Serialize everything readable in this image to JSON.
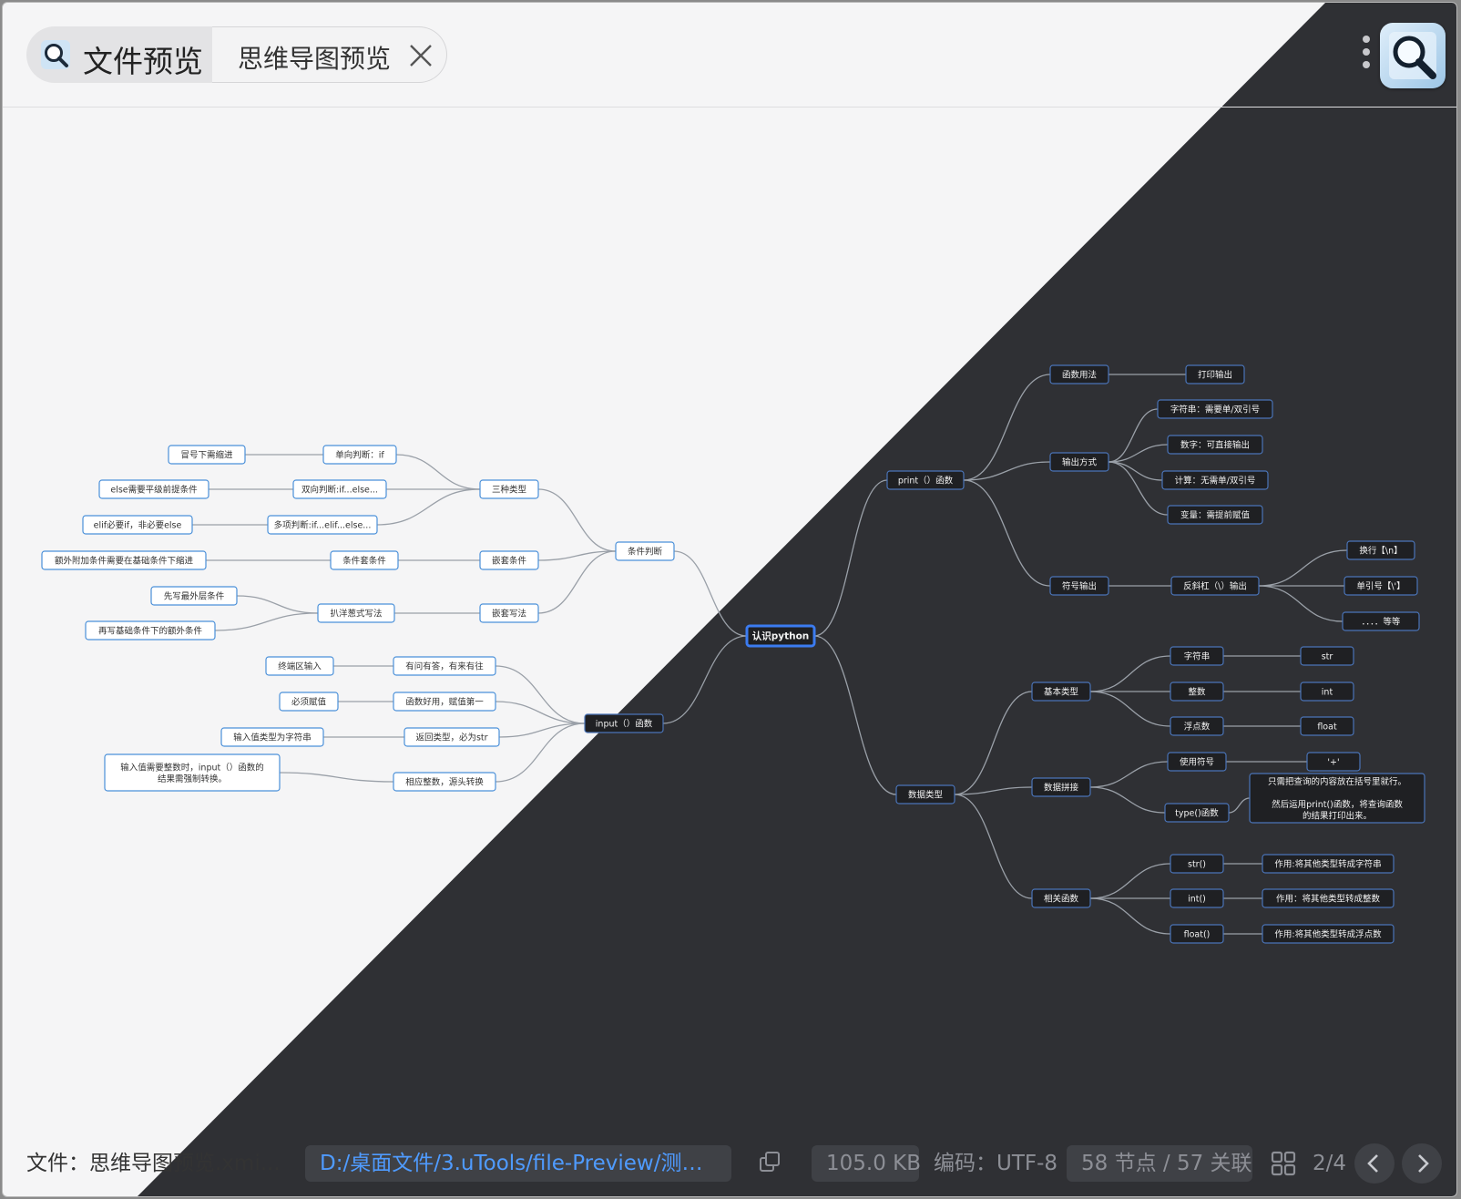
{
  "header": {
    "tab_main_label": "文件预览",
    "tab_sub_label": "思维导图预览"
  },
  "footer": {
    "file_label": "文件：思维导图预览.xmi...",
    "file_path": "D:/桌面文件/3.uTools/file-Preview/测试文...",
    "file_size": "105.0 KB",
    "encoding": "编码：UTF-8",
    "stats": "58 节点 / 57 关联",
    "page_indicator": "2/4"
  },
  "colors": {
    "light_bg": "#f5f5f6",
    "dark_bg": "#2f3034",
    "node_border_light": "#4a90d9",
    "node_border_dark": "#4a74b8",
    "root_border": "#3b7bf0",
    "edge": "#9aa0a8",
    "link": "#4f9bff"
  },
  "mindmap": {
    "root": "认识python",
    "nodes": [
      {
        "id": "root",
        "text": "认识python"
      },
      {
        "id": "print",
        "text": "print（）函数",
        "parent": "root"
      },
      {
        "id": "hs",
        "text": "函数用法",
        "parent": "print"
      },
      {
        "id": "dy",
        "text": "打印输出",
        "parent": "hs"
      },
      {
        "id": "sc",
        "text": "输出方式",
        "parent": "print"
      },
      {
        "id": "sc1",
        "text": "字符串：需要单/双引号",
        "parent": "sc"
      },
      {
        "id": "sc2",
        "text": "数字：可直接输出",
        "parent": "sc"
      },
      {
        "id": "sc3",
        "text": "计算：无需单/双引号",
        "parent": "sc"
      },
      {
        "id": "sc4",
        "text": "变量：需提前赋值",
        "parent": "sc"
      },
      {
        "id": "fh",
        "text": "符号输出",
        "parent": "print"
      },
      {
        "id": "fxg",
        "text": "反斜杠（\\）输出",
        "parent": "fh"
      },
      {
        "id": "fx1",
        "text": "换行【\\n】",
        "parent": "fxg"
      },
      {
        "id": "fx2",
        "text": "单引号【\\'】",
        "parent": "fxg"
      },
      {
        "id": "fx3",
        "text": "．．．．等等",
        "parent": "fxg"
      },
      {
        "id": "sjlx",
        "text": "数据类型",
        "parent": "root"
      },
      {
        "id": "jb",
        "text": "基本类型",
        "parent": "sjlx"
      },
      {
        "id": "zfc",
        "text": "字符串",
        "parent": "jb"
      },
      {
        "id": "str",
        "text": "str",
        "parent": "zfc"
      },
      {
        "id": "zs",
        "text": "整数",
        "parent": "jb"
      },
      {
        "id": "int",
        "text": "int",
        "parent": "zs"
      },
      {
        "id": "fds",
        "text": "浮点数",
        "parent": "jb"
      },
      {
        "id": "float",
        "text": "float",
        "parent": "fds"
      },
      {
        "id": "pj",
        "text": "数据拼接",
        "parent": "sjlx"
      },
      {
        "id": "syfh",
        "text": "使用符号",
        "parent": "pj"
      },
      {
        "id": "plus",
        "text": "'+'",
        "parent": "syfh"
      },
      {
        "id": "typef",
        "text": "type()函数",
        "parent": "pj"
      },
      {
        "id": "typed",
        "text": "只需把查询的内容放在括号里就行。\n\n然后运用print()函数，将查询函数的结果打印出来。",
        "parent": "typef"
      },
      {
        "id": "xg",
        "text": "相关函数",
        "parent": "sjlx"
      },
      {
        "id": "strf",
        "text": "str()",
        "parent": "xg"
      },
      {
        "id": "strd",
        "text": "作用:将其他类型转成字符串",
        "parent": "strf"
      },
      {
        "id": "intf",
        "text": "int()",
        "parent": "xg"
      },
      {
        "id": "intd",
        "text": "作用：将其他类型转成整数",
        "parent": "intf"
      },
      {
        "id": "floatf",
        "text": "float()",
        "parent": "xg"
      },
      {
        "id": "floatd",
        "text": "作用:将其他类型转成浮点数",
        "parent": "floatf"
      },
      {
        "id": "tjpd",
        "text": "条件判断",
        "parent": "root"
      },
      {
        "id": "szlx",
        "text": "三种类型",
        "parent": "tjpd"
      },
      {
        "id": "dx",
        "text": "单向判断：if",
        "parent": "szlx"
      },
      {
        "id": "mh",
        "text": "冒号下需缩进",
        "parent": "dx"
      },
      {
        "id": "sx",
        "text": "双向判断:if...else...",
        "parent": "szlx"
      },
      {
        "id": "elsey",
        "text": "else需要平级前提条件",
        "parent": "sx"
      },
      {
        "id": "dxp",
        "text": "多项判断:if...elif...else...",
        "parent": "szlx"
      },
      {
        "id": "elif",
        "text": "elif必要if，非必要else",
        "parent": "dxp"
      },
      {
        "id": "qt1",
        "text": "嵌套条件",
        "parent": "tjpd"
      },
      {
        "id": "tjtj",
        "text": "条件套条件",
        "parent": "qt1"
      },
      {
        "id": "ew",
        "text": "额外附加条件需要在基础条件下缩进",
        "parent": "tjtj"
      },
      {
        "id": "qt2",
        "text": "嵌套写法",
        "parent": "tjpd"
      },
      {
        "id": "byc",
        "text": "扒洋葱式写法",
        "parent": "qt2"
      },
      {
        "id": "xx",
        "text": "先写最外层条件",
        "parent": "byc"
      },
      {
        "id": "zx",
        "text": "再写基础条件下的额外条件",
        "parent": "byc"
      },
      {
        "id": "input",
        "text": "input（）函数",
        "parent": "root"
      },
      {
        "id": "ywyd",
        "text": "有问有答，有来有往",
        "parent": "input"
      },
      {
        "id": "zd",
        "text": "终端区输入",
        "parent": "ywyd"
      },
      {
        "id": "hshy",
        "text": "函数好用，赋值第一",
        "parent": "input"
      },
      {
        "id": "bxfz",
        "text": "必须赋值",
        "parent": "hshy"
      },
      {
        "id": "fhlx",
        "text": "返回类型，必为str",
        "parent": "input"
      },
      {
        "id": "srlx",
        "text": "输入值类型为字符串",
        "parent": "fhlx"
      },
      {
        "id": "xyzs",
        "text": "相应整数，源头转换",
        "parent": "input"
      },
      {
        "id": "srzs",
        "text": "输入值需要整数时，input（）函数的结果需强制转换。",
        "parent": "xyzs"
      }
    ]
  }
}
